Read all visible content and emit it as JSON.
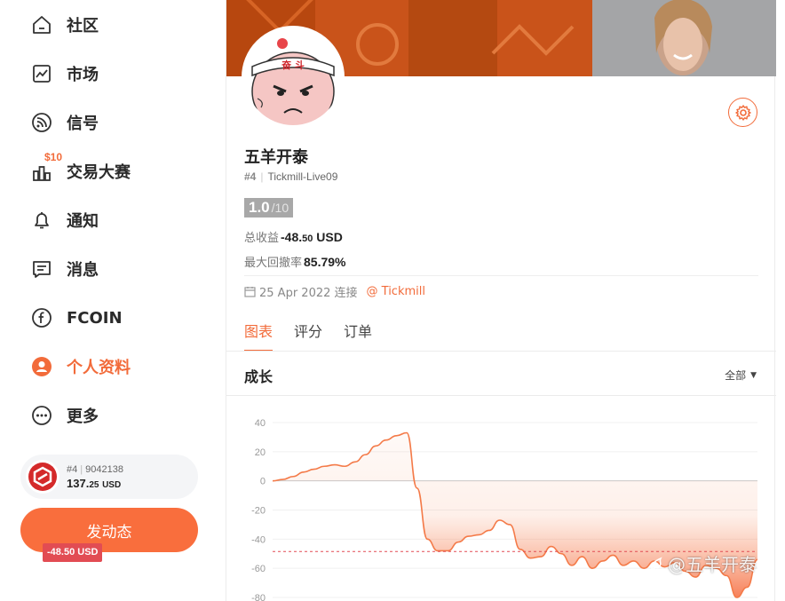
{
  "sidebar": {
    "items": [
      {
        "label": "社区",
        "icon": "home-icon"
      },
      {
        "label": "市场",
        "icon": "chart-icon"
      },
      {
        "label": "信号",
        "icon": "signal-icon"
      },
      {
        "label": "交易大赛",
        "icon": "contest-icon",
        "badge": "$10"
      },
      {
        "label": "通知",
        "icon": "bell-icon"
      },
      {
        "label": "消息",
        "icon": "message-icon"
      },
      {
        "label": "FCOIN",
        "icon": "fcoin-icon"
      },
      {
        "label": "个人资料",
        "icon": "profile-icon",
        "active": true
      },
      {
        "label": "更多",
        "icon": "more-icon"
      }
    ],
    "account": {
      "rank": "#4",
      "number": "9042138",
      "balance_main": "137.",
      "balance_dec": "25",
      "currency": "USD"
    },
    "post_button": "发动态"
  },
  "profile": {
    "avatar_text": "奋 斗",
    "name": "五羊开泰",
    "rank": "#4",
    "account": "Tickmill-Live09",
    "score": "1.0",
    "score_max": "/10",
    "total_profit_label": "总收益",
    "total_profit_main": "-48.",
    "total_profit_dec": "50",
    "total_profit_currency": "USD",
    "drawdown_label": "最大回撤率",
    "drawdown_value": "85.79%",
    "connected": "25 Apr 2022 连接",
    "broker": "@ Tickmill"
  },
  "tabs": [
    "图表",
    "评分",
    "订单"
  ],
  "section": {
    "title": "成长",
    "range": "全部"
  },
  "chart_data": {
    "type": "area",
    "title": "成长",
    "xlabel": "",
    "ylabel": "",
    "ylim": [
      -80,
      40
    ],
    "yticks": [
      40,
      20,
      0,
      -20,
      -40,
      -60,
      -80
    ],
    "current_label": "-48.50 USD",
    "current_value": -48.5,
    "series": [
      {
        "values": [
          0,
          1,
          3,
          6,
          8,
          10,
          11,
          10,
          13,
          18,
          24,
          28,
          31,
          33,
          -5,
          -40,
          -48,
          -48,
          -42,
          -38,
          -37,
          -34,
          -27,
          -30,
          -47,
          -53,
          -52,
          -45,
          -50,
          -58,
          -52,
          -60,
          -55,
          -51,
          -58,
          -55,
          -60,
          -55,
          -59,
          -56,
          -62,
          -66,
          -58,
          -60,
          -65,
          -80,
          -73,
          -54
        ]
      }
    ],
    "color": "#f47a48"
  },
  "watermark": "@五羊开泰"
}
